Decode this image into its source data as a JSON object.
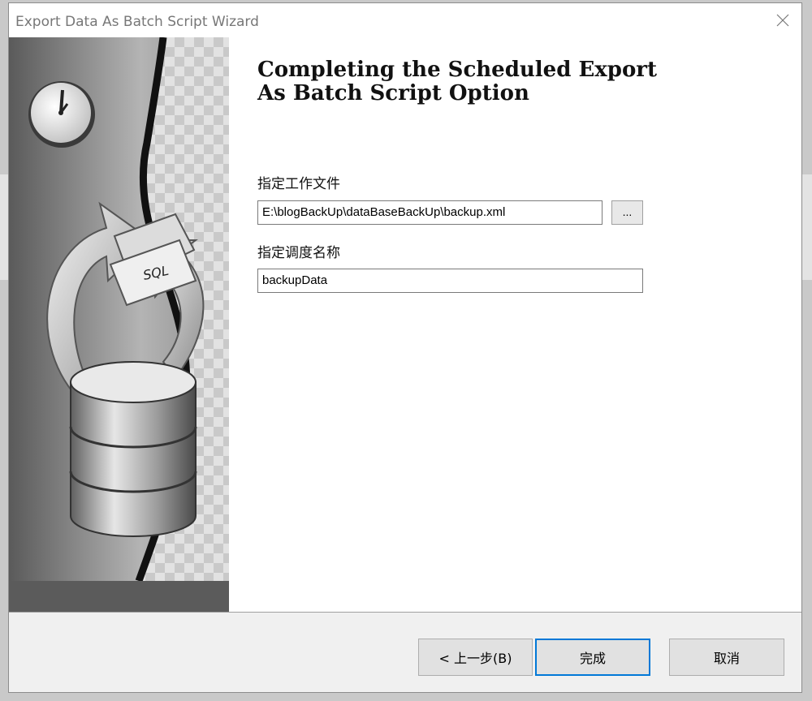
{
  "dialog": {
    "title": "Export Data As Batch Script Wizard",
    "close_icon": "close-icon"
  },
  "content": {
    "heading_line1": "Completing the Scheduled Export",
    "heading_line2": "As Batch Script Option",
    "work_file_label": "指定工作文件",
    "work_file_value": "E:\\blogBackUp\\dataBaseBackUp\\backup.xml",
    "browse_label": "...",
    "schedule_name_label": "指定调度名称",
    "schedule_name_value": "backupData"
  },
  "sidebar": {
    "clock_icon": "clock-icon",
    "folder_icon": "sql-folder-icon",
    "folder_text": "SQL",
    "database_icon": "database-icon"
  },
  "footer": {
    "back_label": "< 上一步(B)",
    "finish_label": "完成",
    "cancel_label": "取消"
  },
  "colors": {
    "accent": "#0078d7",
    "footer_bg": "#f0f0f0",
    "sidebar_bg": "#5b5b5b"
  }
}
